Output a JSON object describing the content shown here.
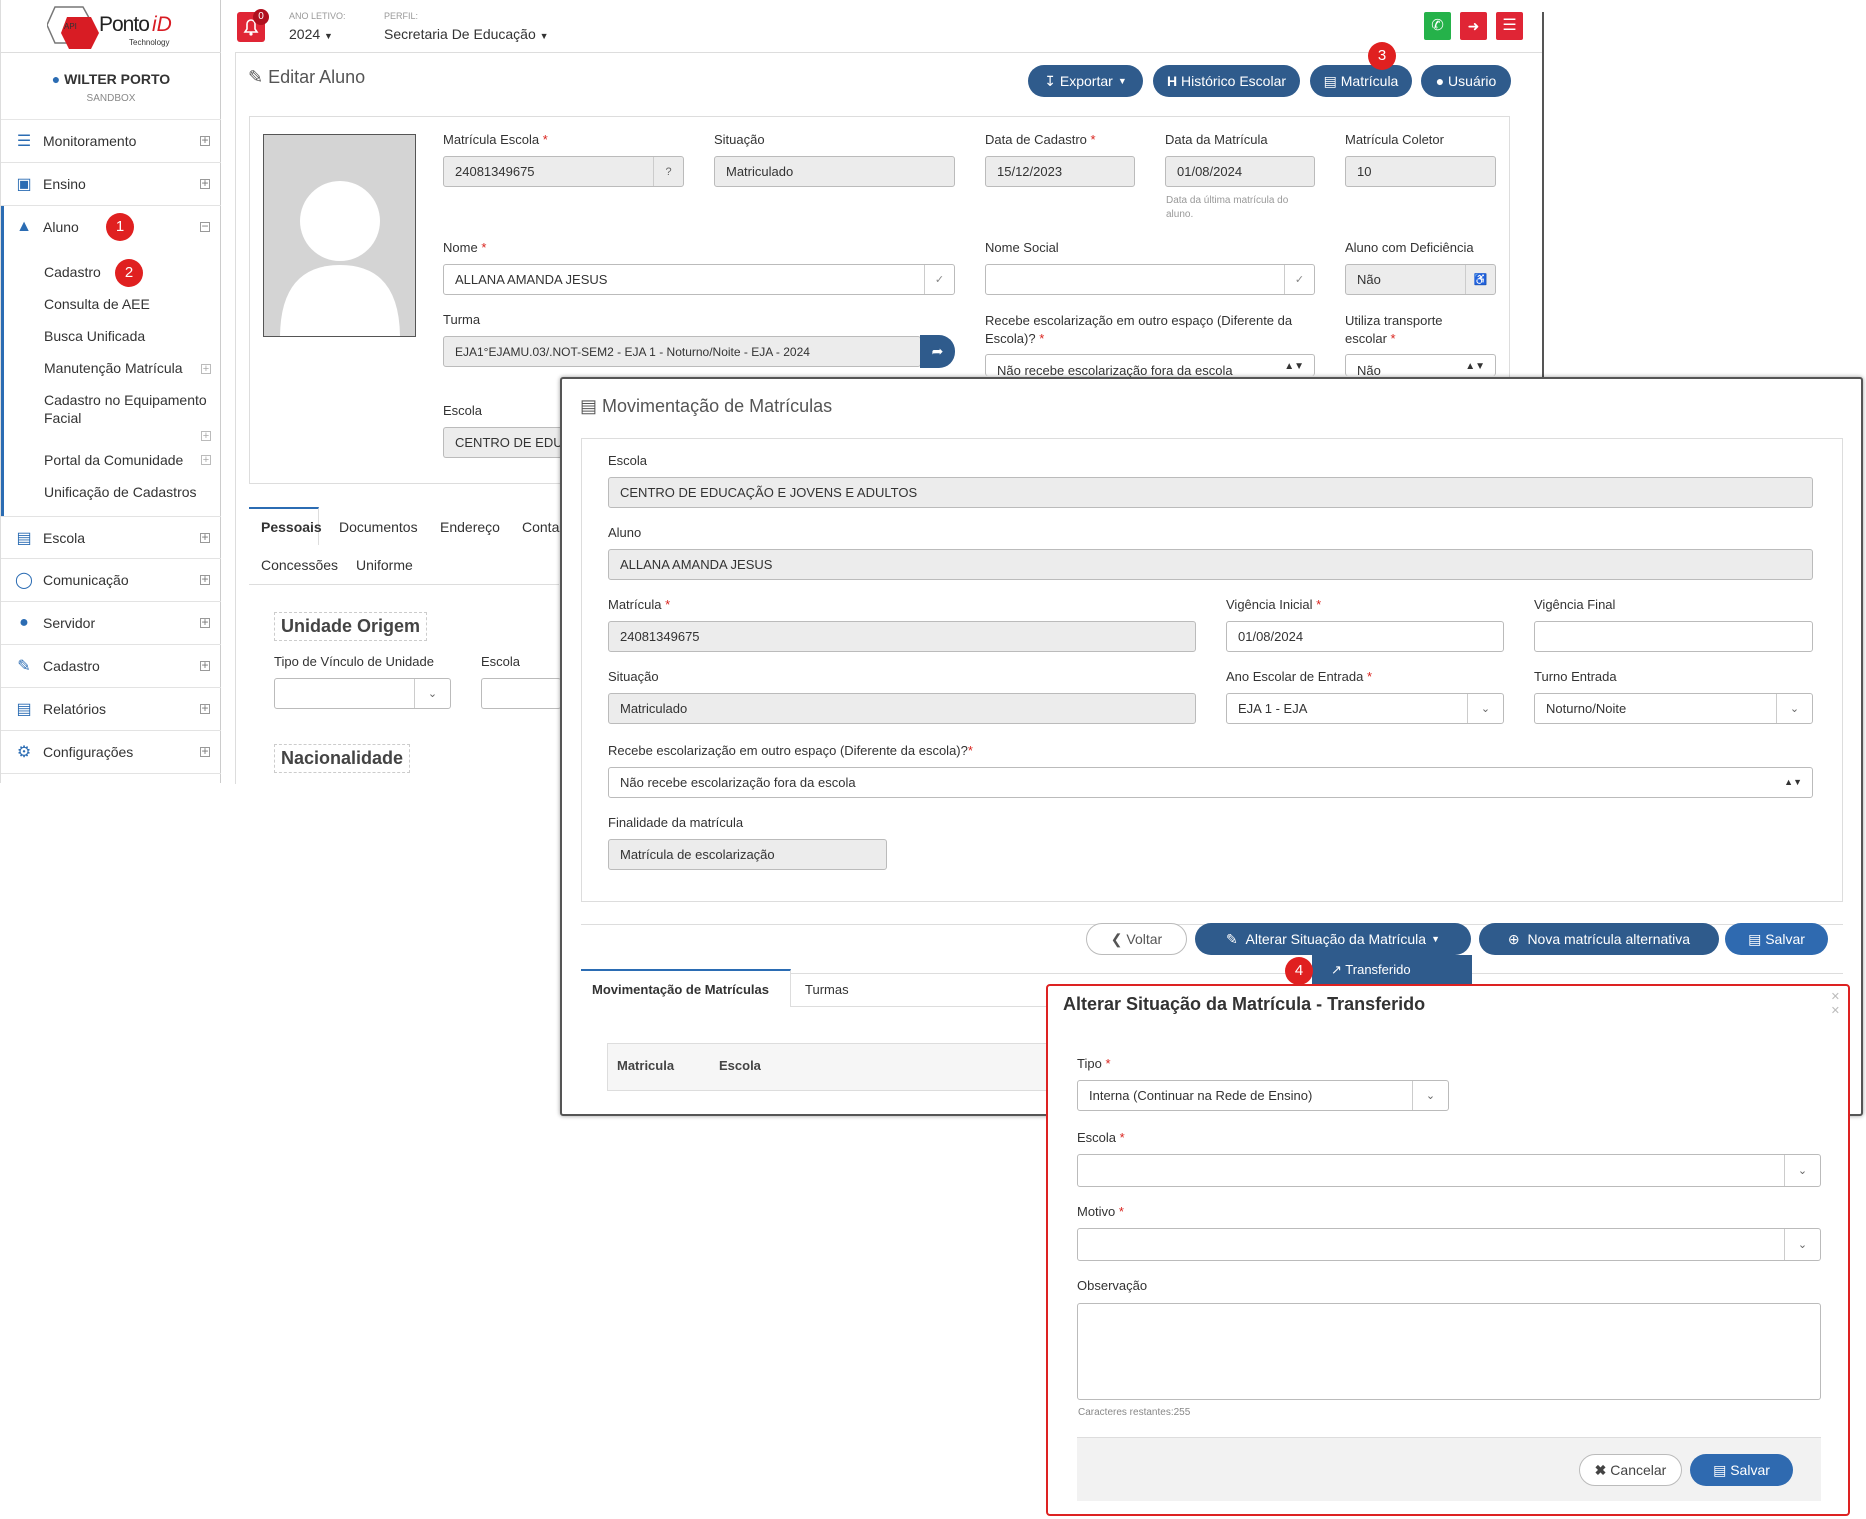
{
  "header": {
    "year_label": "ANO LETIVO:",
    "year": "2024",
    "profile_label": "PERFIL:",
    "profile": "Secretaria De Educação",
    "notif_count": "0"
  },
  "logo": {
    "text": "PontoiD",
    "sub": "Technology",
    "api": "API"
  },
  "user": {
    "name": "WILTER PORTO",
    "env": "SANDBOX"
  },
  "nav": {
    "monitoramento": "Monitoramento",
    "ensino": "Ensino",
    "aluno": "Aluno",
    "cadastro": "Cadastro",
    "consulta_aee": "Consulta de AEE",
    "busca": "Busca Unificada",
    "manutencao": "Manutenção Matrícula",
    "equip1": "Cadastro no Equipamento",
    "equip2": "Facial",
    "portal": "Portal da Comunidade",
    "unificacao": "Unificação de Cadastros",
    "escola": "Escola",
    "comunicacao": "Comunicação",
    "servidor": "Servidor",
    "cadastro2": "Cadastro",
    "relatorios": "Relatórios",
    "config": "Configurações"
  },
  "steps": {
    "s1": "1",
    "s2": "2",
    "s3": "3",
    "s4": "4"
  },
  "page": {
    "title": "Editar Aluno",
    "btn_exportar": "Exportar",
    "btn_historico": "Histórico Escolar",
    "btn_matricula": "Matrícula",
    "btn_usuario": "Usuário"
  },
  "form": {
    "mat_escola_label": "Matrícula Escola",
    "mat_escola": "24081349675",
    "situacao_label": "Situação",
    "situacao": "Matriculado",
    "data_cad_label": "Data de Cadastro",
    "data_cad": "15/12/2023",
    "data_mat_label": "Data da Matrícula",
    "data_mat": "01/08/2024",
    "data_mat_help": "Data da última matrícula do aluno.",
    "mat_coletor_label": "Matrícula Coletor",
    "mat_coletor": "10",
    "nome_label": "Nome",
    "nome": "ALLANA AMANDA JESUS",
    "nome_social_label": "Nome Social",
    "deficiencia_label": "Aluno com Deficiência",
    "deficiencia": "Não",
    "turma_label": "Turma",
    "turma": "EJA1°EJAMU.03/.NOT-SEM2 - EJA 1 - Noturno/Noite - EJA - 2024",
    "recebe_label1": "Recebe escolarização em outro espaço (Diferente da",
    "recebe_label2": "Escola)?",
    "recebe": "Não recebe escolarização fora da escola",
    "transporte_label1": "Utiliza transporte",
    "transporte_label2": "escolar",
    "transporte": "Não",
    "escola_label": "Escola",
    "escola": "CENTRO DE EDUC"
  },
  "tabs": {
    "pessoais": "Pessoais",
    "documentos": "Documentos",
    "endereco": "Endereço",
    "contato": "Conta",
    "concessoes": "Concessões",
    "uniforme": "Uniforme"
  },
  "sections": {
    "origem": "Unidade Origem",
    "vinculo_label": "Tipo de Vínculo de Unidade",
    "escola_label": "Escola",
    "nacionalidade": "Nacionalidade"
  },
  "modal": {
    "title": "Movimentação de Matrículas",
    "escola_label": "Escola",
    "escola": "CENTRO DE EDUCAÇÃO E JOVENS E ADULTOS",
    "aluno_label": "Aluno",
    "aluno": "ALLANA AMANDA JESUS",
    "matricula_label": "Matrícula",
    "matricula": "24081349675",
    "vig_ini_label": "Vigência Inicial",
    "vig_ini": "01/08/2024",
    "vig_fim_label": "Vigência Final",
    "situacao_label": "Situação",
    "situacao": "Matriculado",
    "ano_label": "Ano Escolar de Entrada",
    "ano": "EJA 1 - EJA",
    "turno_label": "Turno Entrada",
    "turno": "Noturno/Noite",
    "recebe_label": "Recebe escolarização em outro espaço (Diferente da escola)?",
    "recebe": "Não recebe escolarização fora da escola",
    "finalidade_label": "Finalidade da matrícula",
    "finalidade": "Matrícula de escolarização",
    "btn_voltar": "Voltar",
    "btn_alterar": "Alterar Situação da Matrícula",
    "btn_nova": "Nova matrícula alternativa",
    "btn_salvar": "Salvar",
    "dropdown_item": "Transferido",
    "tab1": "Movimentação de Matrículas",
    "tab2": "Turmas",
    "col1": "Matricula",
    "col2": "Escola"
  },
  "dialog": {
    "title": "Alterar Situação da Matrícula - Transferido",
    "tipo_label": "Tipo",
    "tipo": "Interna (Continuar na Rede de Ensino)",
    "escola_label": "Escola",
    "motivo_label": "Motivo",
    "obs_label": "Observação",
    "chars": "Caracteres restantes:255",
    "btn_cancelar": "Cancelar",
    "btn_salvar": "Salvar"
  }
}
